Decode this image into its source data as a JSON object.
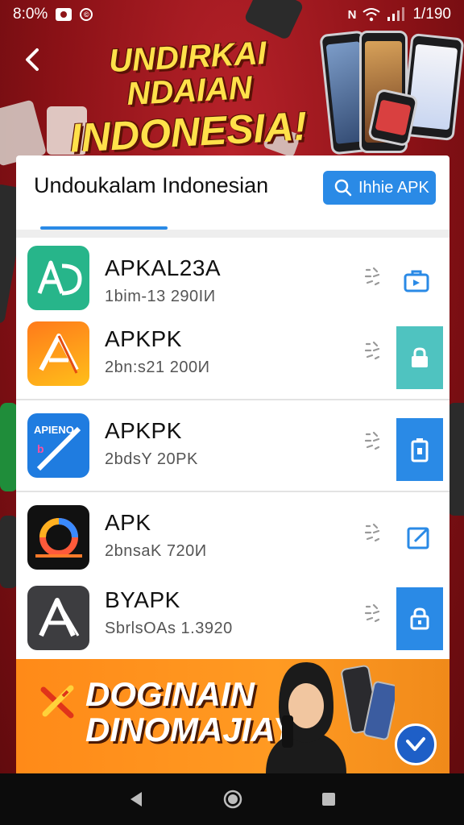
{
  "status_bar": {
    "left_text": "8:0%",
    "right_text": "1/190",
    "network_label": "N"
  },
  "header": {
    "headline_line1": "UNDIRKAI NDAIAN",
    "headline_line2": "INDONESIA!"
  },
  "card": {
    "title": "Undoukalam Indonesian",
    "search_label": "Ihhie APK"
  },
  "apps": [
    {
      "name": "APKAL23A",
      "meta": "1bim-13 290IИ",
      "icon_text": "AD",
      "action": "share-icon"
    },
    {
      "name": "APKPK",
      "meta": "2bn:s21 200И",
      "icon_text": "",
      "action": "lock-icon"
    },
    {
      "name": "APKPK",
      "meta": "2bdsY 20PK",
      "icon_text": "APIENO",
      "action": "battery-lock-icon"
    },
    {
      "name": "APK",
      "meta": "2bnsaK 720И",
      "icon_text": "",
      "action": "edit-icon"
    },
    {
      "name": "BYAPK",
      "meta": "SbrlsOAs 1.3920",
      "icon_text": "",
      "action": "lock-icon"
    }
  ],
  "promo": {
    "line1": "DOGINAIN",
    "line2": "DINOMAJIAY"
  },
  "colors": {
    "accent": "#2a8ae6",
    "teal": "#4fc3c0",
    "promo": "#ff8a18",
    "headline": "#ffe14a"
  }
}
